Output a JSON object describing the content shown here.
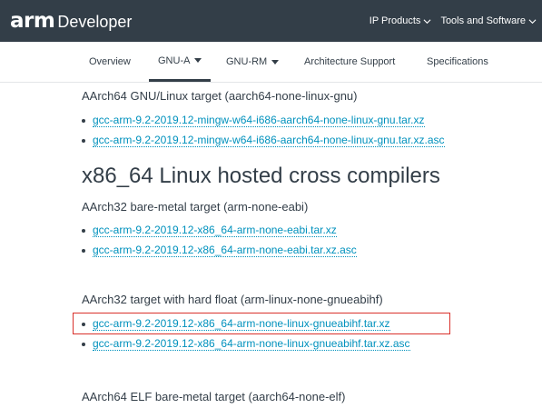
{
  "header": {
    "logo_arm": "arm",
    "logo_developer": "Developer",
    "nav": [
      {
        "label": "IP Products"
      },
      {
        "label": "Tools and Software"
      }
    ]
  },
  "subnav": {
    "items": [
      {
        "label": "Overview"
      },
      {
        "label": "GNU-A"
      },
      {
        "label": "GNU-RM"
      },
      {
        "label": "Architecture Support"
      },
      {
        "label": "Specifications"
      }
    ]
  },
  "content": {
    "section1_target": "AArch64 GNU/Linux target (aarch64-none-linux-gnu)",
    "section1_links": [
      "gcc-arm-9.2-2019.12-mingw-w64-i686-aarch64-none-linux-gnu.tar.xz",
      "gcc-arm-9.2-2019.12-mingw-w64-i686-aarch64-none-linux-gnu.tar.xz.asc"
    ],
    "heading": "x86_64 Linux hosted cross compilers",
    "section2_target": "AArch32 bare-metal target (arm-none-eabi)",
    "section2_links": [
      "gcc-arm-9.2-2019.12-x86_64-arm-none-eabi.tar.xz",
      "gcc-arm-9.2-2019.12-x86_64-arm-none-eabi.tar.xz.asc"
    ],
    "section3_target": "AArch32 target with hard float (arm-linux-none-gnueabihf)",
    "section3_links": [
      "gcc-arm-9.2-2019.12-x86_64-arm-none-linux-gnueabihf.tar.xz",
      "gcc-arm-9.2-2019.12-x86_64-arm-none-linux-gnueabihf.tar.xz.asc"
    ],
    "section4_target": "AArch64 ELF bare-metal target (aarch64-none-elf)"
  },
  "colors": {
    "header_bg": "#333e48",
    "link": "#0091bd",
    "highlight_border": "#d9312b"
  }
}
